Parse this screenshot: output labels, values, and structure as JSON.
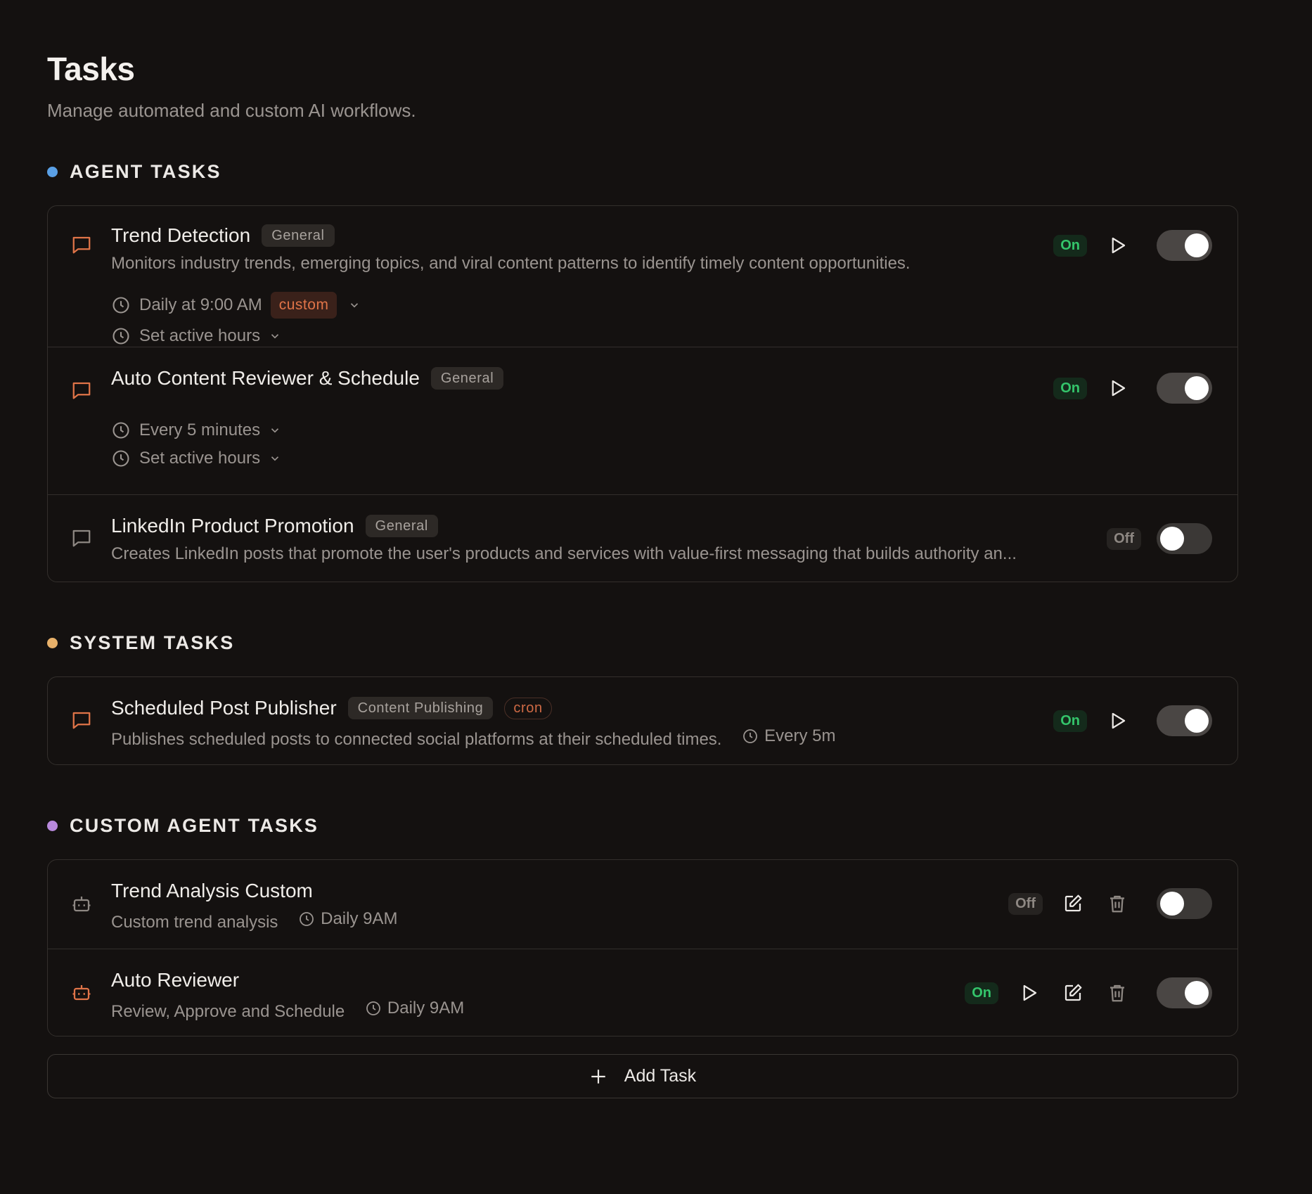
{
  "header": {
    "title": "Tasks",
    "subtitle": "Manage automated and custom AI workflows."
  },
  "colors": {
    "background": "#141110",
    "agent_dot": "#5aa0e6",
    "system_dot": "#e8b16a",
    "custom_dot": "#b889dc",
    "accent_orange": "#e07448",
    "on_green": "#34c56b"
  },
  "agent_tasks": {
    "label": "AGENT TASKS",
    "items": [
      {
        "name": "Trend Detection",
        "tag": "General",
        "description": "Monitors industry trends, emerging topics, and viral content patterns to identify timely content opportunities.",
        "schedule": "Daily at 9:00 AM",
        "schedule_badge": "custom",
        "active_hours": "Set active hours",
        "status": "On",
        "enabled": true,
        "icon": "message-square-icon"
      },
      {
        "name": "Auto Content Reviewer & Schedule",
        "tag": "General",
        "schedule": "Every 5 minutes",
        "active_hours": "Set active hours",
        "status": "On",
        "enabled": true,
        "icon": "message-square-icon"
      },
      {
        "name": "LinkedIn Product Promotion",
        "tag": "General",
        "description": "Creates LinkedIn posts that promote the user's products and services with value-first messaging that builds authority an...",
        "status": "Off",
        "enabled": false,
        "icon": "message-square-icon"
      }
    ]
  },
  "system_tasks": {
    "label": "SYSTEM TASKS",
    "items": [
      {
        "name": "Scheduled Post Publisher",
        "tag": "Content Publishing",
        "tag2": "cron",
        "description": "Publishes scheduled posts to connected social platforms at their scheduled times.",
        "interval": "Every 5m",
        "status": "On",
        "enabled": true,
        "icon": "message-square-icon"
      }
    ]
  },
  "custom_tasks": {
    "label": "CUSTOM AGENT TASKS",
    "items": [
      {
        "name": "Trend Analysis Custom",
        "description": "Custom trend analysis",
        "interval": "Daily 9AM",
        "status": "Off",
        "enabled": false,
        "icon": "bot-icon"
      },
      {
        "name": "Auto Reviewer",
        "description": "Review, Approve and Schedule",
        "interval": "Daily 9AM",
        "status": "On",
        "enabled": true,
        "icon": "bot-icon"
      }
    ]
  },
  "add_task": {
    "label": "Add Task"
  }
}
